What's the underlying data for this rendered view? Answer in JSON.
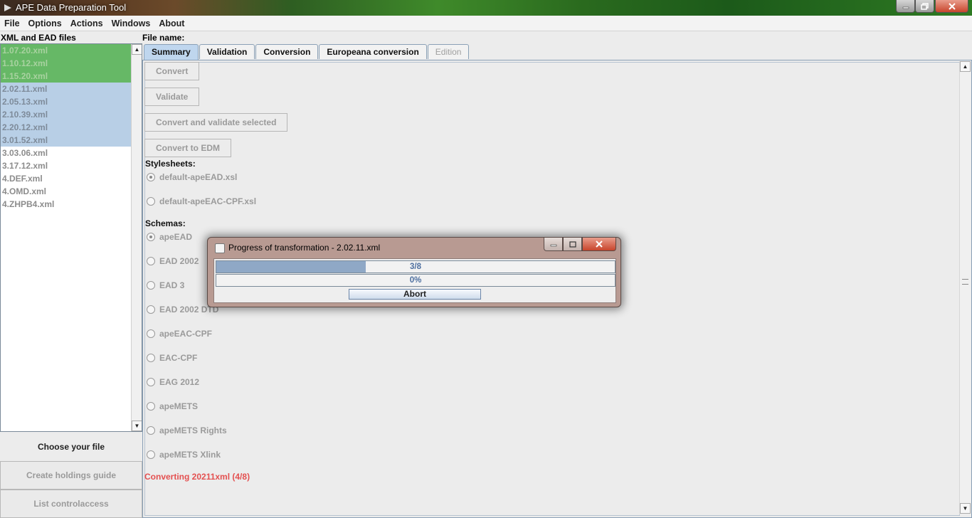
{
  "window": {
    "title": "APE Data Preparation Tool"
  },
  "menu": [
    "File",
    "Options",
    "Actions",
    "Windows",
    "About"
  ],
  "left_panel": {
    "label": "XML and EAD files",
    "files": [
      {
        "name": "1.07.20.xml",
        "state": "converted"
      },
      {
        "name": "1.10.12.xml",
        "state": "converted"
      },
      {
        "name": "1.15.20.xml",
        "state": "converted"
      },
      {
        "name": "2.02.11.xml",
        "state": "selected"
      },
      {
        "name": "2.05.13.xml",
        "state": "selected"
      },
      {
        "name": "2.10.39.xml",
        "state": "selected"
      },
      {
        "name": "2.20.12.xml",
        "state": "selected"
      },
      {
        "name": "3.01.52.xml",
        "state": "selected"
      },
      {
        "name": "3.03.06.xml",
        "state": "normal"
      },
      {
        "name": "3.17.12.xml",
        "state": "normal"
      },
      {
        "name": "4.DEF.xml",
        "state": "normal"
      },
      {
        "name": "4.OMD.xml",
        "state": "normal"
      },
      {
        "name": "4.ZHPB4.xml",
        "state": "normal"
      }
    ],
    "choose_file": "Choose your file",
    "holdings_guide": "Create holdings guide",
    "list_controlaccess": "List controlaccess"
  },
  "main": {
    "file_name_label": "File name:",
    "tabs": [
      "Summary",
      "Validation",
      "Conversion",
      "Europeana conversion",
      "Edition"
    ],
    "buttons": {
      "convert": "Convert",
      "validate": "Validate",
      "convert_validate": "Convert and validate selected",
      "convert_edm": "Convert to EDM"
    },
    "stylesheets_label": "Stylesheets:",
    "stylesheets": [
      "default-apeEAD.xsl",
      "default-apeEAC-CPF.xsl"
    ],
    "schemas_label": "Schemas:",
    "schemas": [
      "apeEAD",
      "EAD 2002",
      "EAD 3",
      "EAD 2002 DTD",
      "apeEAC-CPF",
      "EAC-CPF",
      "EAG 2012",
      "apeMETS",
      "apeMETS Rights",
      "apeMETS Xlink"
    ],
    "status": "Converting 20211xml (4/8)"
  },
  "dialog": {
    "title": "Progress of transformation - 2.02.11.xml",
    "progress_main": "3/8",
    "progress_main_fraction": 0.375,
    "progress_sub": "0%",
    "progress_sub_fraction": 0,
    "abort": "Abort"
  },
  "colors": {
    "converted_row": "#66b866",
    "selected_row": "#b8cfe6",
    "status_text": "#e45050",
    "progress_fill": "#8fa8c6"
  }
}
